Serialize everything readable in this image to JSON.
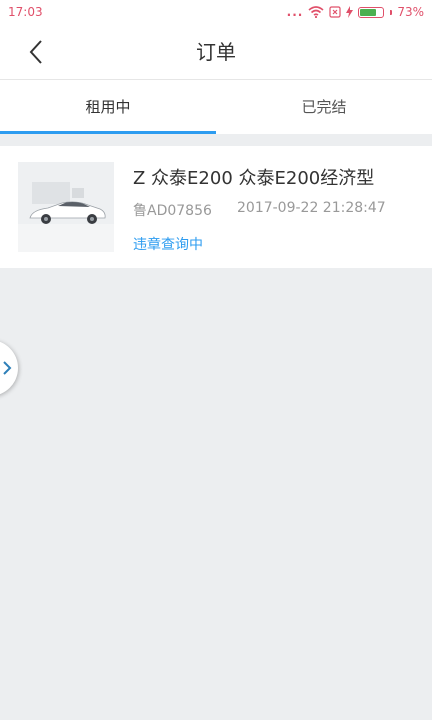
{
  "status_bar": {
    "time": "17:03",
    "signal_dots": "...",
    "battery_percent": "73%",
    "battery_level": 0.73
  },
  "header": {
    "title": "订单"
  },
  "tabs": [
    {
      "label": "租用中",
      "active": true
    },
    {
      "label": "已完结",
      "active": false
    }
  ],
  "orders": [
    {
      "title": "Z 众泰E200 众泰E200经济型",
      "plate": "鲁AD07856",
      "datetime": "2017-09-22 21:28:47",
      "status": "违章查询中"
    }
  ],
  "icons": {
    "back": "chevron-left-icon",
    "side_handle": "chevron-right-icon"
  },
  "colors": {
    "accent": "#2d9cf0",
    "background": "#eceef0",
    "status_bar_text": "#e0506a",
    "battery_fill": "#4caf50"
  }
}
